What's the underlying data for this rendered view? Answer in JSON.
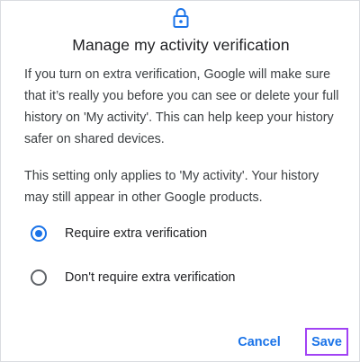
{
  "dialog": {
    "icon": "lock-icon",
    "title": "Manage my activity verification",
    "paragraphs": [
      "If you turn on extra verification, Google will make sure that it’s really you before you can see or delete your full history on 'My activity'. This can help keep your history safer on shared devices.",
      "This setting only applies to 'My activity'. Your history may still appear in other Google products."
    ],
    "options": [
      {
        "label": "Require extra verification",
        "selected": true
      },
      {
        "label": "Don't require extra verification",
        "selected": false
      }
    ],
    "buttons": {
      "cancel": "Cancel",
      "save": "Save"
    }
  },
  "colors": {
    "accent": "#1a73e8",
    "highlight_border": "#a142f4",
    "text_primary": "#202124",
    "text_secondary": "#3c4043"
  }
}
